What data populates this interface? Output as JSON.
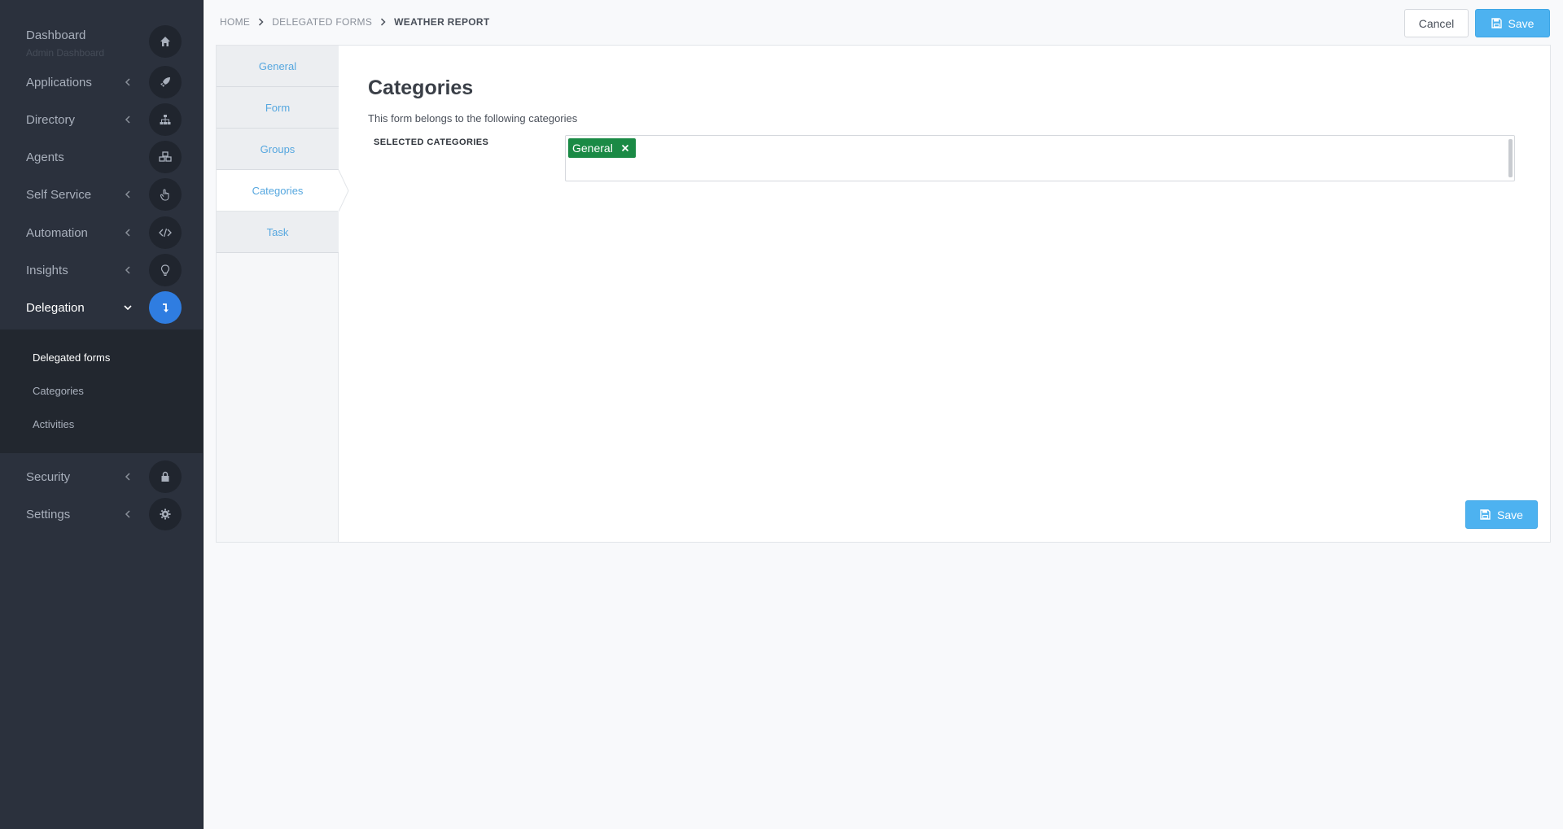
{
  "sidebar": {
    "dashboard": {
      "label": "Dashboard",
      "subtitle": "Admin Dashboard",
      "icon": "home-icon"
    },
    "items": [
      {
        "label": "Applications",
        "icon": "rocket-icon"
      },
      {
        "label": "Directory",
        "icon": "sitemap-icon"
      },
      {
        "label": "Agents",
        "icon": "cubes-icon"
      },
      {
        "label": "Self Service",
        "icon": "hand-pointer-icon"
      },
      {
        "label": "Automation",
        "icon": "code-icon"
      },
      {
        "label": "Insights",
        "icon": "lightbulb-icon"
      },
      {
        "label": "Delegation",
        "icon": "level-down-icon"
      },
      {
        "label": "Security",
        "icon": "lock-icon"
      },
      {
        "label": "Settings",
        "icon": "gear-icon"
      }
    ],
    "delegation_submenu": [
      "Delegated forms",
      "Categories",
      "Activities"
    ]
  },
  "breadcrumb": [
    "HOME",
    "DELEGATED FORMS",
    "WEATHER REPORT"
  ],
  "header": {
    "cancel_label": "Cancel",
    "save_label": "Save"
  },
  "tabs": [
    "General",
    "Form",
    "Groups",
    "Categories",
    "Task"
  ],
  "content": {
    "title": "Categories",
    "description": "This form belongs to the following categories",
    "field_label": "SELECTED CATEGORIES",
    "selected_tags": [
      "General"
    ],
    "save_label": "Save"
  },
  "colors": {
    "accent": "#2f7de1",
    "save": "#4db2f0",
    "tag": "#1a8a45",
    "tab_text": "#56a7df"
  }
}
